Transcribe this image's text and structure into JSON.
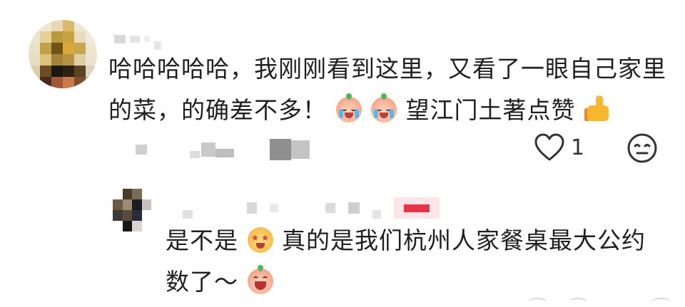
{
  "main_comment": {
    "text_part1": "哈哈哈哈哈，我刚刚看到这里，又看了一眼自己家里的菜，的确差不多！",
    "emoji_1": "cry-laugh-emoji",
    "emoji_2": "cry-laugh-emoji",
    "text_part2": "望江门土著点赞",
    "emoji_3": "thumbs-up-emoji",
    "like_count": "1",
    "like_icon": "heart-outline-icon",
    "reply_icon": "emoji-reply-icon"
  },
  "reply_comment": {
    "emoji_1": "dazzled-emoji",
    "text_part1": "是不是",
    "text_part2": "真的是我们杭州人家餐桌最大公约数了～",
    "emoji_2": "laughing-emoji"
  },
  "colors": {
    "text": "#1f1f1f",
    "author_tag_bg": "#fde6ea",
    "author_tag_fg": "#e6334a",
    "icon": "#333333"
  }
}
